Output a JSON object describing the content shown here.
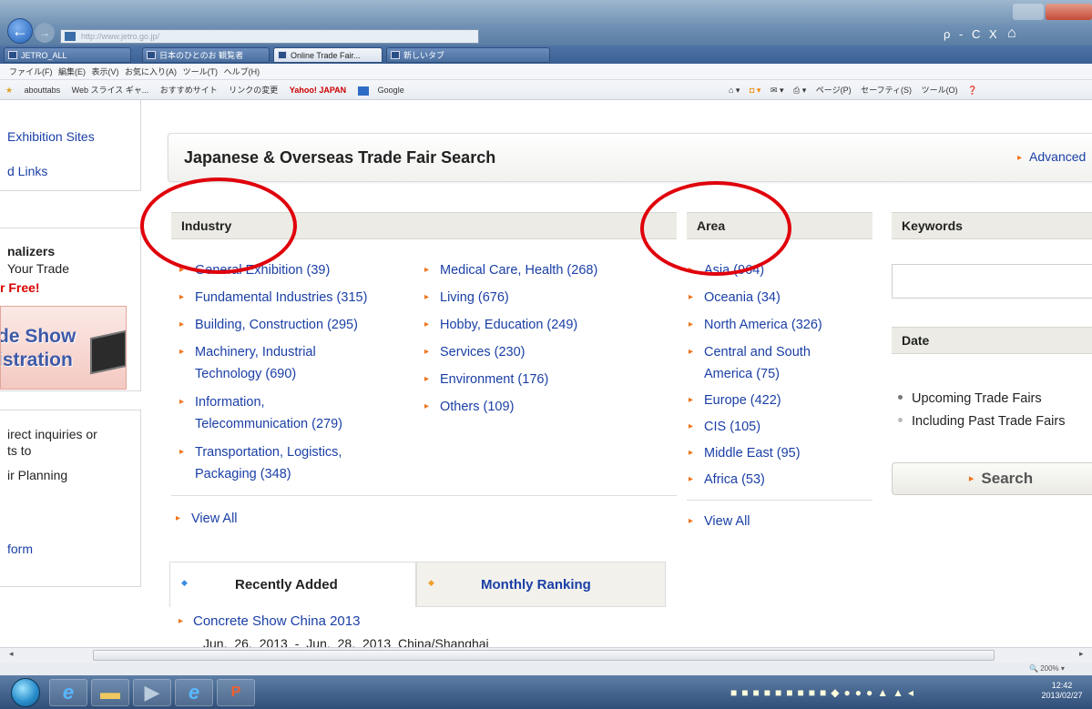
{
  "browser": {
    "address": "http://www.jetro.go.jp/",
    "tabs": [
      "JETRO_ALL",
      "日本のひとのお 観覧者",
      "Online Trade Fair...",
      "新しいタブ"
    ],
    "menu": [
      "ファイル(F)",
      "編集(E)",
      "表示(V)",
      "お気に入り(A)",
      "ツール(T)",
      "ヘルプ(H)"
    ],
    "favorites": [
      "abouttabs",
      "Web スライス ギャ...",
      "おすすめサイト",
      "リンクの変更",
      "Yahoo! JAPAN",
      "Google"
    ],
    "commands": [
      "ページ(P)",
      "セーフティ(S)",
      "ツール(O)"
    ],
    "addr_controls": "ρ - C X",
    "zoom": "200%",
    "clock_time": "12:42",
    "clock_date": "2013/02/27"
  },
  "left_nav": {
    "exhibition_sites": "Exhibition Sites",
    "links": "d Links",
    "analyzers": "nalizers",
    "your_trade": "Your Trade",
    "free": "r Free!",
    "banner_line1": "de Show",
    "banner_line2": "istration",
    "inquiries": "irect inquiries or",
    "ts_to": "ts to",
    "planning": "ir Planning",
    "form": "form"
  },
  "search": {
    "title": "Japanese & Overseas Trade Fair Search",
    "advanced": "Advanced",
    "industry_heading": "Industry",
    "area_heading": "Area",
    "keywords_heading": "Keywords",
    "date_heading": "Date",
    "industry_col1": [
      {
        "l1": "General Exhibition (39)"
      },
      {
        "l1": "Fundamental Industries (315)"
      },
      {
        "l1": "Building, Construction (295)"
      },
      {
        "l1": "Machinery, Industrial",
        "l2": "Technology (690)"
      },
      {
        "l1": "Information,",
        "l2": "Telecommunication (279)"
      },
      {
        "l1": "Transportation, Logistics,",
        "l2": "Packaging (348)"
      }
    ],
    "industry_col2": [
      {
        "l1": "Medical Care, Health (268)"
      },
      {
        "l1": "Living (676)"
      },
      {
        "l1": "Hobby, Education (249)"
      },
      {
        "l1": "Services (230)"
      },
      {
        "l1": "Environment (176)"
      },
      {
        "l1": "Others (109)"
      }
    ],
    "areas": [
      {
        "l1": "Asia (964)"
      },
      {
        "l1": "Oceania (34)"
      },
      {
        "l1": "North America (326)"
      },
      {
        "l1": "Central and South",
        "l2": "America (75)"
      },
      {
        "l1": "Europe (422)"
      },
      {
        "l1": "CIS (105)"
      },
      {
        "l1": "Middle East (95)"
      },
      {
        "l1": "Africa (53)"
      }
    ],
    "view_all": "View All",
    "date_upcoming": "Upcoming Trade Fairs",
    "date_past": "Including Past Trade Fairs",
    "search_button": "Search"
  },
  "lower_tabs": {
    "recent": "Recently Added",
    "monthly": "Monthly Ranking",
    "recent_item_title": "Concrete Show China 2013",
    "recent_item_date": "Jun. 26, 2013 - Jun. 28, 2013 China/Shanghai"
  },
  "colors": {
    "link": "#1a3fa6",
    "bullet": "#f0741c",
    "annotation": "#e0000b"
  }
}
